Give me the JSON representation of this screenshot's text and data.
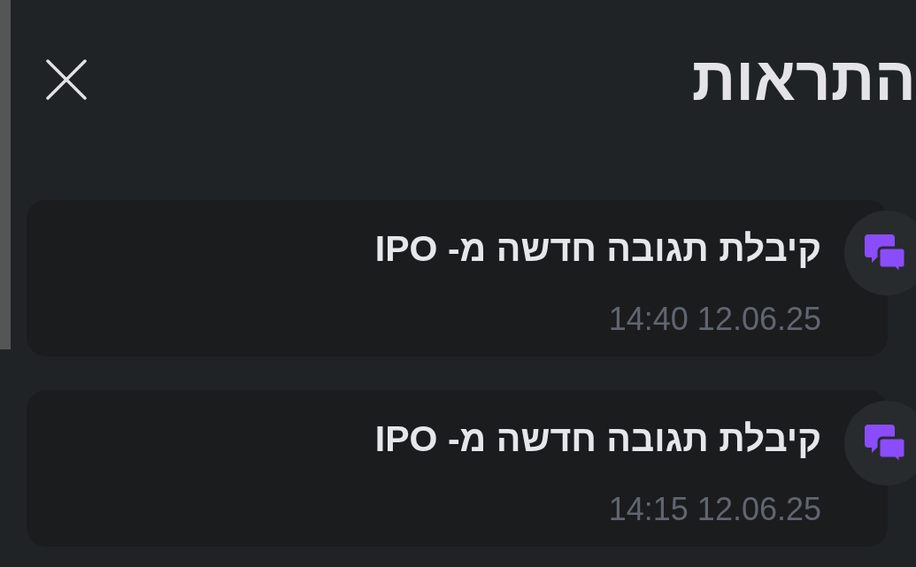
{
  "header": {
    "title": "התראות"
  },
  "notifications": [
    {
      "message": "קיבלת תגובה חדשה מ- IPO",
      "timestamp": "14:40 12.06.25"
    },
    {
      "message": "קיבלת תגובה חדשה מ- IPO",
      "timestamp": "14:15 12.06.25"
    }
  ]
}
